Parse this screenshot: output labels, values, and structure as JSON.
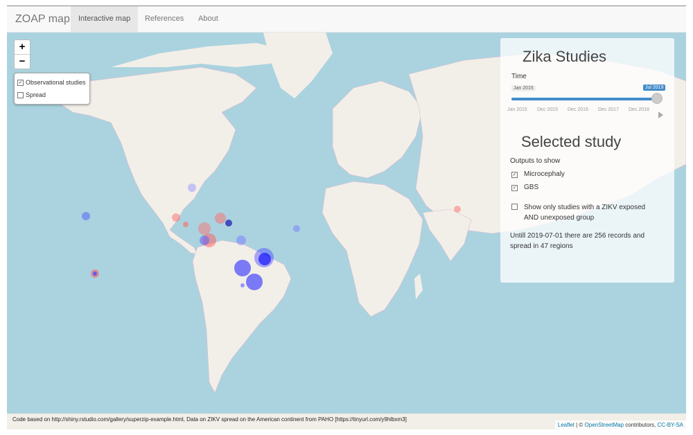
{
  "navbar": {
    "brand": "ZOAP map",
    "tabs": [
      {
        "label": "Interactive map",
        "active": true
      },
      {
        "label": "References",
        "active": false
      },
      {
        "label": "About",
        "active": false
      }
    ]
  },
  "map": {
    "zoom_in": "+",
    "zoom_out": "−",
    "layers": [
      {
        "label": "Observational studies",
        "checked": true
      },
      {
        "label": "Spread",
        "checked": false
      }
    ]
  },
  "panel": {
    "title": "Zika Studies",
    "time_label": "Time",
    "slider": {
      "from_label": "Jan 2015",
      "to_label": "Jul 2019",
      "value_fraction": 1.0,
      "ticks": [
        "Jan 2015",
        "Dec 2015",
        "Dec 2016",
        "Dec 2017",
        "Dec 2018"
      ]
    },
    "selected_title": "Selected study",
    "outputs_label": "Outputs to show",
    "outputs": [
      {
        "label": "Microcephaly",
        "checked": true
      },
      {
        "label": "GBS",
        "checked": true
      }
    ],
    "exposed_option": {
      "line1": "Show only studies with a ZIKV exposed",
      "line2": "AND unexposed group",
      "checked": false
    },
    "summary_line1": "Untill 2019-07-01 there are 256 records and",
    "summary_line2": "spread in 47 regions"
  },
  "attribution": {
    "left": "Code based on http://shiny.rstudio.com/gallery/superzip-example.html, Data on ZIKV spread on the American continent from PAHO [https://tinyurl.com/y9hlbxm3]",
    "leaflet": "Leaflet",
    "sep": " | © ",
    "osm": "OpenStreetMap",
    "contributors": " contributors, ",
    "license": "CC-BY-SA"
  },
  "colors": {
    "water": "#aad3df",
    "land": "#f2efe9",
    "study_blue": "#1a1aff",
    "study_red": "#ff6b6b",
    "slider_accent": "#428bca"
  }
}
